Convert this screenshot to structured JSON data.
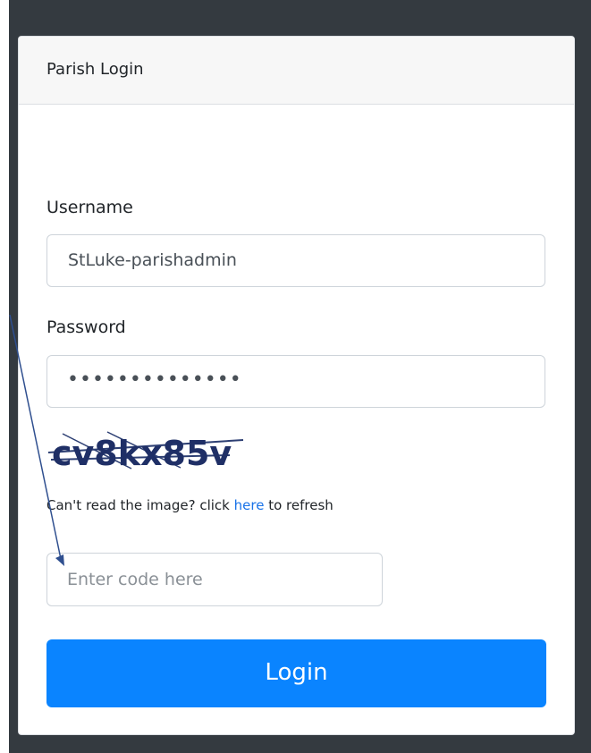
{
  "card": {
    "title": "Parish Login"
  },
  "form": {
    "username_label": "Username",
    "username_value": "StLuke-parishadmin",
    "password_label": "Password",
    "password_mask": "••••••••••••••",
    "captcha_text": "cv8kx85v",
    "captcha_help_before": "Can't read the image? click ",
    "captcha_help_link": "here",
    "captcha_help_after": " to refresh",
    "code_placeholder": "Enter code here",
    "login_label": "Login"
  },
  "colors": {
    "button_bg": "#0a84ff",
    "dark_background": "#343a40",
    "link": "#1a73e8"
  },
  "icons": {
    "arrow": "annotation-arrow-icon"
  }
}
